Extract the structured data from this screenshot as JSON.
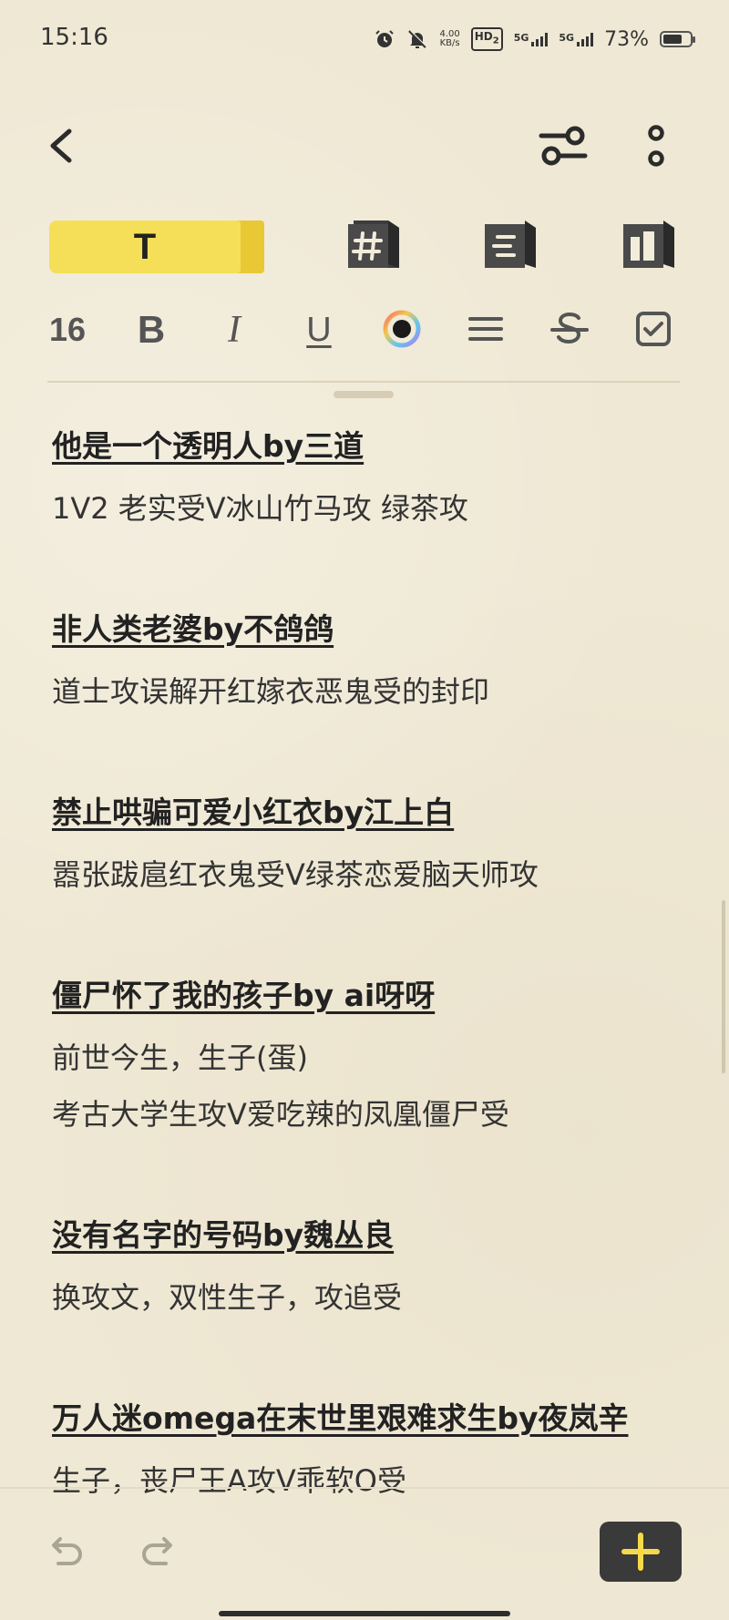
{
  "status_bar": {
    "time": "15:16",
    "net_speed_value": "4.00",
    "net_speed_unit": "KB/s",
    "hd_label": "HD",
    "hd_sub": "2",
    "signal1_label": "5G",
    "signal2_label": "5G",
    "battery_percent": "73%",
    "battery_level": 0.73
  },
  "header": {
    "icons": [
      "back-icon",
      "filter-sliders-icon",
      "more-vertical-icon"
    ]
  },
  "mode_tabs": {
    "text_label": "T",
    "icons": [
      "text-mode-icon",
      "hashtag-icon",
      "list-mode-icon",
      "layout-mode-icon"
    ]
  },
  "format_toolbar": {
    "font_size": "16",
    "bold": "B",
    "italic": "I",
    "underline": "U",
    "icons": [
      "color-picker-icon",
      "align-icon",
      "strikethrough-icon",
      "checkbox-icon"
    ]
  },
  "entries": [
    {
      "title": "他是一个透明人by三道",
      "lines": [
        "1V2 老实受V冰山竹马攻 绿茶攻"
      ]
    },
    {
      "title": "非人类老婆by不鸽鸽",
      "lines": [
        "道士攻误解开红嫁衣恶鬼受的封印"
      ]
    },
    {
      "title": "禁止哄骗可爱小红衣by江上白",
      "lines": [
        "嚣张跋扈红衣鬼受V绿茶恋爱脑天师攻"
      ]
    },
    {
      "title": "僵尸怀了我的孩子by ai呀呀",
      "lines": [
        "前世今生，生子(蛋)",
        "考古大学生攻V爱吃辣的凤凰僵尸受"
      ]
    },
    {
      "title": "没有名字的号码by魏丛良",
      "lines": [
        "换攻文，双性生子，攻追受"
      ]
    },
    {
      "title": "万人迷omega在末世里艰难求生by夜岚辛",
      "lines": [
        "生子，丧尸王A攻V乖软O受"
      ]
    }
  ],
  "bottom_bar": {
    "icons": [
      "undo-icon",
      "redo-icon",
      "add-icon"
    ]
  },
  "colors": {
    "background": "#efe8d4",
    "accent_yellow": "#f6df58",
    "dark": "#3a3a3a"
  }
}
